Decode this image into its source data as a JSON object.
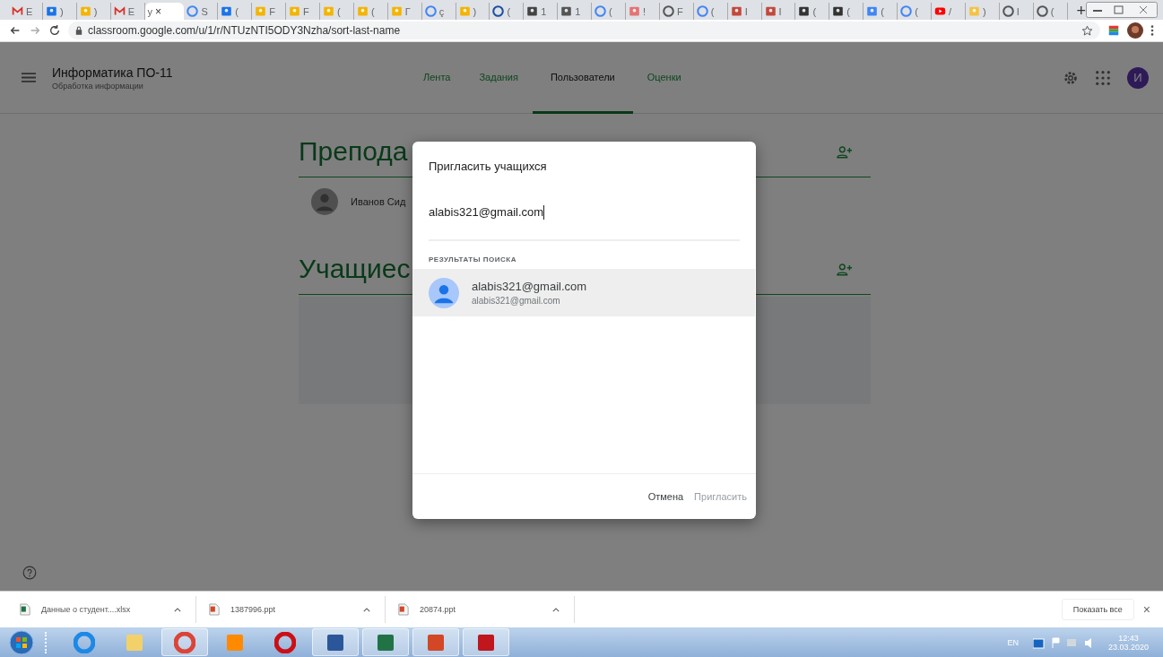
{
  "browser": {
    "tabs": [
      {
        "kind": "gmail",
        "label": "E",
        "selected": false
      },
      {
        "kind": "contacts",
        "label": ")",
        "selected": false
      },
      {
        "kind": "classroom",
        "label": ")",
        "selected": false
      },
      {
        "kind": "gmail",
        "label": "E",
        "selected": false
      },
      {
        "kind": "blank",
        "label": "y",
        "selected": true
      },
      {
        "kind": "google",
        "label": "S",
        "selected": false
      },
      {
        "kind": "contacts",
        "label": "(",
        "selected": false
      },
      {
        "kind": "classroom",
        "label": "F",
        "selected": false
      },
      {
        "kind": "classroom",
        "label": "F",
        "selected": false
      },
      {
        "kind": "classroom",
        "label": "(",
        "selected": false
      },
      {
        "kind": "classroom",
        "label": "(",
        "selected": false
      },
      {
        "kind": "classroom",
        "label": "Г",
        "selected": false
      },
      {
        "kind": "google",
        "label": "ç",
        "selected": false
      },
      {
        "kind": "classroom",
        "label": ")",
        "selected": false
      },
      {
        "kind": "shield",
        "label": "(",
        "selected": false
      },
      {
        "kind": "s",
        "label": "1",
        "selected": false
      },
      {
        "kind": "image",
        "label": "1",
        "selected": false
      },
      {
        "kind": "google",
        "label": "(",
        "selected": false
      },
      {
        "kind": "arc",
        "label": "!",
        "selected": false
      },
      {
        "kind": "globe",
        "label": "F",
        "selected": false
      },
      {
        "kind": "google",
        "label": "(",
        "selected": false
      },
      {
        "kind": "slides",
        "label": "I",
        "selected": false
      },
      {
        "kind": "slides",
        "label": "I",
        "selected": false
      },
      {
        "kind": "pdf",
        "label": "(",
        "selected": false
      },
      {
        "kind": "pdf",
        "label": "(",
        "selected": false
      },
      {
        "kind": "docs",
        "label": "(",
        "selected": false
      },
      {
        "kind": "google",
        "label": "(",
        "selected": false
      },
      {
        "kind": "youtube",
        "label": "/",
        "selected": false
      },
      {
        "kind": "hand",
        "label": ")",
        "selected": false
      },
      {
        "kind": "globe",
        "label": "I",
        "selected": false
      },
      {
        "kind": "globe",
        "label": "(",
        "selected": false
      }
    ],
    "tab_close": "×",
    "new_tab": "+",
    "url": "classroom.google.com/u/1/r/NTUzNTI5ODY3Nzha/sort-last-name"
  },
  "app": {
    "class_title": "Информатика ПО-11",
    "class_subtitle": "Обработка информации",
    "nav": [
      {
        "label": "Лента",
        "selected": false
      },
      {
        "label": "Задания",
        "selected": false
      },
      {
        "label": "Пользователи",
        "selected": true
      },
      {
        "label": "Оценки",
        "selected": false
      }
    ],
    "avatar_initial": "И",
    "teachers": {
      "heading": "Препода",
      "people": [
        "Иванов Сид"
      ]
    },
    "students": {
      "heading": "Учащиес"
    }
  },
  "dialog": {
    "title": "Пригласить учащихся",
    "value": "alabis321@gmail.com",
    "results_heading": "РЕЗУЛЬТАТЫ ПОИСКА",
    "results": [
      {
        "name": "alabis321@gmail.com",
        "email": "alabis321@gmail.com",
        "selected": true
      }
    ],
    "cancel": "Отмена",
    "invite": {
      "label": "Пригласить",
      "disabled": true
    }
  },
  "downloads": {
    "items": [
      {
        "kind": "excel",
        "name": "Данные о студент....xlsx"
      },
      {
        "kind": "ppt",
        "name": "1387996.ppt"
      },
      {
        "kind": "ppt",
        "name": "20874.ppt"
      }
    ],
    "show_all": "Показать все",
    "close": "×"
  },
  "taskbar": {
    "apps": [
      {
        "kind": "ie",
        "active": false
      },
      {
        "kind": "folder",
        "active": false
      },
      {
        "kind": "chrome",
        "active": true
      },
      {
        "kind": "media",
        "active": false
      },
      {
        "kind": "opera",
        "active": false
      },
      {
        "kind": "word",
        "active": true
      },
      {
        "kind": "excel",
        "active": true
      },
      {
        "kind": "powerpoint",
        "active": true
      },
      {
        "kind": "acrobat",
        "active": true
      }
    ],
    "language": "EN",
    "time": "12:43",
    "date": "23.03.2020"
  }
}
